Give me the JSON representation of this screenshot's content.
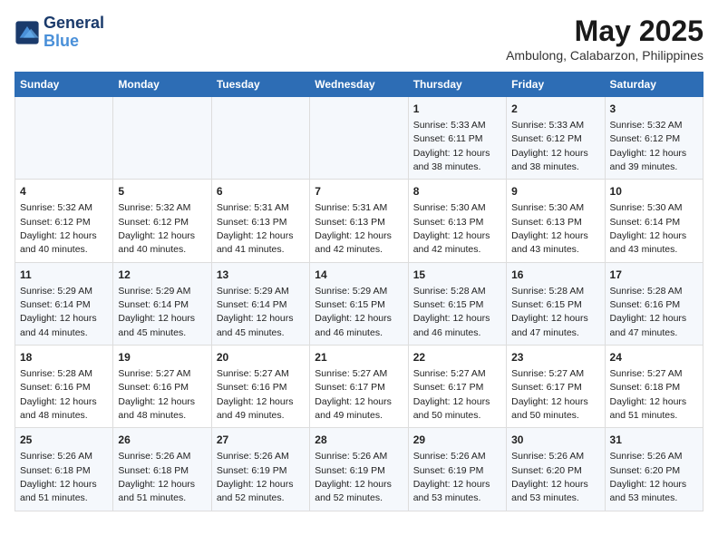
{
  "header": {
    "logo_line1": "General",
    "logo_line2": "Blue",
    "title": "May 2025",
    "subtitle": "Ambulong, Calabarzon, Philippines"
  },
  "days_of_week": [
    "Sunday",
    "Monday",
    "Tuesday",
    "Wednesday",
    "Thursday",
    "Friday",
    "Saturday"
  ],
  "weeks": [
    [
      {
        "day": "",
        "info": ""
      },
      {
        "day": "",
        "info": ""
      },
      {
        "day": "",
        "info": ""
      },
      {
        "day": "",
        "info": ""
      },
      {
        "day": "1",
        "info": "Sunrise: 5:33 AM\nSunset: 6:11 PM\nDaylight: 12 hours\nand 38 minutes."
      },
      {
        "day": "2",
        "info": "Sunrise: 5:33 AM\nSunset: 6:12 PM\nDaylight: 12 hours\nand 38 minutes."
      },
      {
        "day": "3",
        "info": "Sunrise: 5:32 AM\nSunset: 6:12 PM\nDaylight: 12 hours\nand 39 minutes."
      }
    ],
    [
      {
        "day": "4",
        "info": "Sunrise: 5:32 AM\nSunset: 6:12 PM\nDaylight: 12 hours\nand 40 minutes."
      },
      {
        "day": "5",
        "info": "Sunrise: 5:32 AM\nSunset: 6:12 PM\nDaylight: 12 hours\nand 40 minutes."
      },
      {
        "day": "6",
        "info": "Sunrise: 5:31 AM\nSunset: 6:13 PM\nDaylight: 12 hours\nand 41 minutes."
      },
      {
        "day": "7",
        "info": "Sunrise: 5:31 AM\nSunset: 6:13 PM\nDaylight: 12 hours\nand 42 minutes."
      },
      {
        "day": "8",
        "info": "Sunrise: 5:30 AM\nSunset: 6:13 PM\nDaylight: 12 hours\nand 42 minutes."
      },
      {
        "day": "9",
        "info": "Sunrise: 5:30 AM\nSunset: 6:13 PM\nDaylight: 12 hours\nand 43 minutes."
      },
      {
        "day": "10",
        "info": "Sunrise: 5:30 AM\nSunset: 6:14 PM\nDaylight: 12 hours\nand 43 minutes."
      }
    ],
    [
      {
        "day": "11",
        "info": "Sunrise: 5:29 AM\nSunset: 6:14 PM\nDaylight: 12 hours\nand 44 minutes."
      },
      {
        "day": "12",
        "info": "Sunrise: 5:29 AM\nSunset: 6:14 PM\nDaylight: 12 hours\nand 45 minutes."
      },
      {
        "day": "13",
        "info": "Sunrise: 5:29 AM\nSunset: 6:14 PM\nDaylight: 12 hours\nand 45 minutes."
      },
      {
        "day": "14",
        "info": "Sunrise: 5:29 AM\nSunset: 6:15 PM\nDaylight: 12 hours\nand 46 minutes."
      },
      {
        "day": "15",
        "info": "Sunrise: 5:28 AM\nSunset: 6:15 PM\nDaylight: 12 hours\nand 46 minutes."
      },
      {
        "day": "16",
        "info": "Sunrise: 5:28 AM\nSunset: 6:15 PM\nDaylight: 12 hours\nand 47 minutes."
      },
      {
        "day": "17",
        "info": "Sunrise: 5:28 AM\nSunset: 6:16 PM\nDaylight: 12 hours\nand 47 minutes."
      }
    ],
    [
      {
        "day": "18",
        "info": "Sunrise: 5:28 AM\nSunset: 6:16 PM\nDaylight: 12 hours\nand 48 minutes."
      },
      {
        "day": "19",
        "info": "Sunrise: 5:27 AM\nSunset: 6:16 PM\nDaylight: 12 hours\nand 48 minutes."
      },
      {
        "day": "20",
        "info": "Sunrise: 5:27 AM\nSunset: 6:16 PM\nDaylight: 12 hours\nand 49 minutes."
      },
      {
        "day": "21",
        "info": "Sunrise: 5:27 AM\nSunset: 6:17 PM\nDaylight: 12 hours\nand 49 minutes."
      },
      {
        "day": "22",
        "info": "Sunrise: 5:27 AM\nSunset: 6:17 PM\nDaylight: 12 hours\nand 50 minutes."
      },
      {
        "day": "23",
        "info": "Sunrise: 5:27 AM\nSunset: 6:17 PM\nDaylight: 12 hours\nand 50 minutes."
      },
      {
        "day": "24",
        "info": "Sunrise: 5:27 AM\nSunset: 6:18 PM\nDaylight: 12 hours\nand 51 minutes."
      }
    ],
    [
      {
        "day": "25",
        "info": "Sunrise: 5:26 AM\nSunset: 6:18 PM\nDaylight: 12 hours\nand 51 minutes."
      },
      {
        "day": "26",
        "info": "Sunrise: 5:26 AM\nSunset: 6:18 PM\nDaylight: 12 hours\nand 51 minutes."
      },
      {
        "day": "27",
        "info": "Sunrise: 5:26 AM\nSunset: 6:19 PM\nDaylight: 12 hours\nand 52 minutes."
      },
      {
        "day": "28",
        "info": "Sunrise: 5:26 AM\nSunset: 6:19 PM\nDaylight: 12 hours\nand 52 minutes."
      },
      {
        "day": "29",
        "info": "Sunrise: 5:26 AM\nSunset: 6:19 PM\nDaylight: 12 hours\nand 53 minutes."
      },
      {
        "day": "30",
        "info": "Sunrise: 5:26 AM\nSunset: 6:20 PM\nDaylight: 12 hours\nand 53 minutes."
      },
      {
        "day": "31",
        "info": "Sunrise: 5:26 AM\nSunset: 6:20 PM\nDaylight: 12 hours\nand 53 minutes."
      }
    ]
  ]
}
